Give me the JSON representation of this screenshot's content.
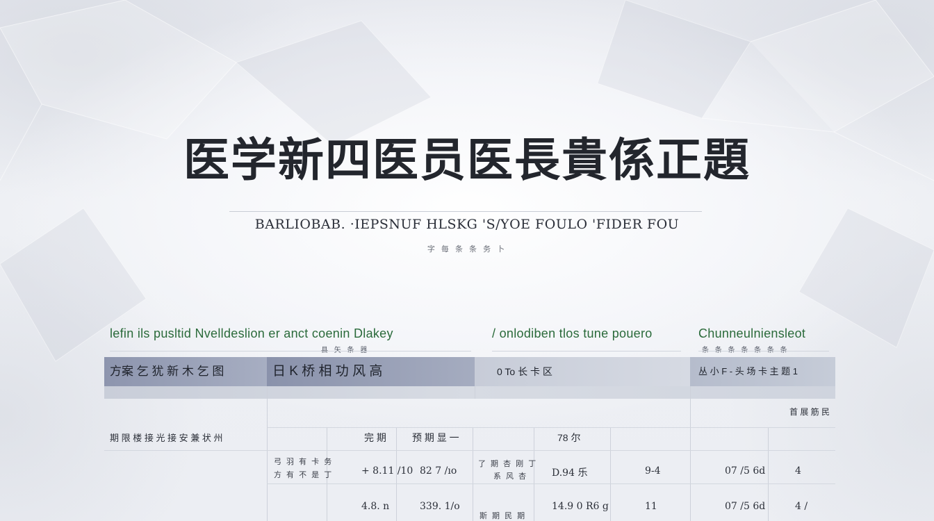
{
  "document": {
    "title": "医学新四医员医長貴係正題",
    "subtitle": "BARLIOBAB. ·IEPSNUF HLSKG 'S/YOE FOULO 'FIDER FOU",
    "caption": "字 毎 条 条 务 卜"
  },
  "sections": [
    {
      "heading": "lefin ils pusltid Nvelldeslion er anct coenin Dlakey",
      "sub": "县 矢 条 器"
    },
    {
      "heading": "/ onlodiben tlos tune pouero",
      "sub": ""
    },
    {
      "heading": "Chunneulniensleot",
      "sub": "条 条 条 条 条 条 条"
    }
  ],
  "table": {
    "headers": [
      "方案 乞 犹 新 木 乞 图",
      "日 K  桥 相 功  风 高",
      "0 To 长 卡 区",
      "丛 小 F - 头 场 卡 主 题  1"
    ],
    "unit_note": "首 展 筋 民",
    "rows": [
      {
        "label": "期 限 楼 接 光 接 安 兼 状 州",
        "col2": "",
        "col3": "完 期",
        "col4": "预 期 显 一",
        "col5": "",
        "col6": "78 尔",
        "col7": "",
        "col8": "",
        "col9": ""
      },
      {
        "label": "",
        "col2a": "弓 羽 有 卡 务",
        "col2b": "方 有 不 是 丁",
        "col3": "+ 8.11 /10",
        "col4": "82 7 /ıo",
        "col5a": "了 期 杏 刚 丁",
        "col5b": "系 风 杏",
        "col6": "D.94 乐",
        "col7": "9-4",
        "col8": "07 /5 6d",
        "col9": "4"
      },
      {
        "label": "",
        "col3": "4.8. n",
        "col4": "339. 1/o",
        "col5": "斯 期 民 期",
        "col6": "14.9 0 R6 g",
        "col7": "11",
        "col8": "07 /5 6d",
        "col9": "4 /"
      }
    ]
  },
  "colors": {
    "header_dark": "#8d95ae",
    "header_light": "#c7ccd8",
    "section_heading": "#2a6a3a"
  }
}
